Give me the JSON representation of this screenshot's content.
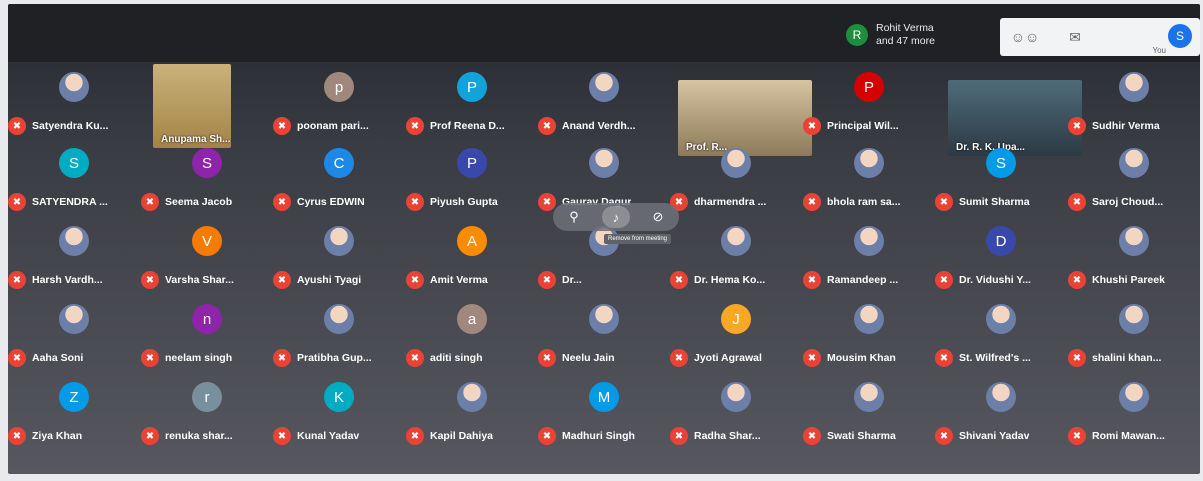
{
  "header": {
    "participants_avatar_letter": "R",
    "participants_line1": "Rohit Verma",
    "participants_line2": "and 47 more",
    "self_letter": "S",
    "self_label": "You"
  },
  "hover_tooltip": "Remove from meeting",
  "tiles": {
    "row1": [
      {
        "name": "Satyendra Ku...",
        "letter": "",
        "color": "#6b7fa8"
      },
      {
        "name": "Anupama Sh...",
        "video": true
      },
      {
        "name": "poonam pari...",
        "letter": "p",
        "color": "#a1887f"
      },
      {
        "name": "Prof Reena D...",
        "letter": "P",
        "color": "#12a4d9"
      },
      {
        "name": "Anand Verdh...",
        "letter": "",
        "color": "#3a5f9e"
      },
      {
        "name": "Prof. R...",
        "video": true
      },
      {
        "name": "Principal Wil...",
        "letter": "P",
        "color": "#d50000"
      },
      {
        "name": "Dr. R. K. Upa...",
        "video": true
      },
      {
        "name": "Sudhir Verma",
        "letter": "",
        "color": "#5b8f4a"
      }
    ],
    "row2": [
      {
        "name": "SATYENDRA ...",
        "letter": "S",
        "color": "#00acc1"
      },
      {
        "name": "Seema Jacob",
        "letter": "S",
        "color": "#8e24aa"
      },
      {
        "name": "Cyrus EDWIN",
        "letter": "C",
        "color": "#1e88e5"
      },
      {
        "name": "Piyush Gupta",
        "letter": "P",
        "color": "#3949ab"
      },
      {
        "name": "Gaurav Dagur",
        "letter": "",
        "color": "#bdbdbd"
      },
      {
        "name": "dharmendra ...",
        "letter": "",
        "color": "#7cb342"
      },
      {
        "name": "bhola ram sa...",
        "letter": "",
        "color": "#5d4037"
      },
      {
        "name": "Sumit Sharma",
        "letter": "S",
        "color": "#039be5"
      },
      {
        "name": "Saroj Choud...",
        "letter": "",
        "color": "#c9a27e"
      }
    ],
    "row3": [
      {
        "name": "Harsh Vardh...",
        "letter": "",
        "color": "#90a4ae"
      },
      {
        "name": "Varsha Shar...",
        "letter": "V",
        "color": "#f57c00"
      },
      {
        "name": "Ayushi Tyagi",
        "letter": "",
        "color": "#4fc3f7"
      },
      {
        "name": "Amit Verma",
        "letter": "A",
        "color": "#fb8c00"
      },
      {
        "name": "Dr...",
        "letter": "",
        "color": "#616161"
      },
      {
        "name": "Dr. Hema Ko...",
        "letter": "",
        "color": "#80cbc4"
      },
      {
        "name": "Ramandeep ...",
        "letter": "",
        "color": "#f8bbd0"
      },
      {
        "name": "Dr. Vidushi Y...",
        "letter": "D",
        "color": "#3949ab"
      },
      {
        "name": "Khushi Pareek",
        "letter": "",
        "color": "#b0bec5"
      }
    ],
    "row4": [
      {
        "name": "Aaha Soni",
        "letter": "",
        "color": "#d7a77f"
      },
      {
        "name": "neelam singh",
        "letter": "n",
        "color": "#8e24aa"
      },
      {
        "name": "Pratibha Gup...",
        "letter": "",
        "color": "#c9a27e"
      },
      {
        "name": "aditi singh",
        "letter": "a",
        "color": "#a1887f"
      },
      {
        "name": "Neelu Jain",
        "letter": "",
        "color": "#e57373"
      },
      {
        "name": "Jyoti Agrawal",
        "letter": "J",
        "color": "#f9a825"
      },
      {
        "name": "Mousim Khan",
        "letter": "",
        "color": "#cfd8dc"
      },
      {
        "name": "St. Wilfred's ...",
        "letter": "",
        "color": "#e3f2fd"
      },
      {
        "name": "shalini khan...",
        "letter": "",
        "color": "#ef9a9a"
      }
    ],
    "row5": [
      {
        "name": "Ziya Khan",
        "letter": "Z",
        "color": "#039be5"
      },
      {
        "name": "renuka shar...",
        "letter": "r",
        "color": "#78909c"
      },
      {
        "name": "Kunal Yadav",
        "letter": "K",
        "color": "#00acc1"
      },
      {
        "name": "Kapil Dahiya",
        "letter": "",
        "color": "#8d9e6b"
      },
      {
        "name": "Madhuri Singh",
        "letter": "M",
        "color": "#039be5"
      },
      {
        "name": "Radha Shar...",
        "letter": "",
        "color": "#4fc3f7"
      },
      {
        "name": "Swati Sharma",
        "letter": "",
        "color": "#90caf9"
      },
      {
        "name": "Shivani Yadav",
        "letter": "",
        "color": "#26a69a"
      },
      {
        "name": "Romi Mawan...",
        "letter": "",
        "color": "#bcaaa4"
      }
    ]
  }
}
